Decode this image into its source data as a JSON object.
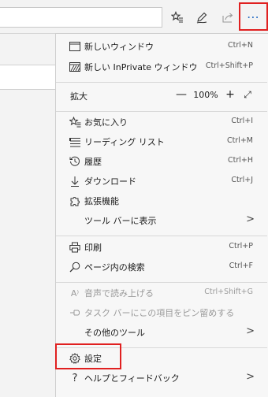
{
  "colors": {
    "accent": "#2b6fc6",
    "highlight": "#e02020"
  },
  "toolbar": {
    "favorites_add_icon": "star-plus-icon",
    "pen_icon": "pen-icon",
    "share_icon": "share-icon",
    "more_label": "⋯"
  },
  "menu": {
    "new_window": {
      "label": "新しいウィンドウ",
      "shortcut": "Ctrl+N"
    },
    "new_inprivate": {
      "label": "新しい InPrivate ウィンドウ",
      "shortcut": "Ctrl+Shift+P"
    },
    "zoom": {
      "label": "拡大",
      "minus": "—",
      "value": "100%",
      "plus": "+",
      "expand": "⤢"
    },
    "favorites": {
      "label": "お気に入り",
      "shortcut": "Ctrl+I"
    },
    "reading_list": {
      "label": "リーディング リスト",
      "shortcut": "Ctrl+M"
    },
    "history": {
      "label": "履歴",
      "shortcut": "Ctrl+H"
    },
    "downloads": {
      "label": "ダウンロード",
      "shortcut": "Ctrl+J"
    },
    "extensions": {
      "label": "拡張機能"
    },
    "show_in_toolbar": {
      "label": "ツール バーに表示",
      "arrow": ">"
    },
    "print": {
      "label": "印刷",
      "shortcut": "Ctrl+P"
    },
    "find": {
      "label": "ページ内の検索",
      "shortcut": "Ctrl+F"
    },
    "read_aloud": {
      "label": "音声で読み上げる",
      "shortcut": "Ctrl+Shift+G"
    },
    "pin_taskbar": {
      "label": "タスク バーにこの項目をピン留めする"
    },
    "more_tools": {
      "label": "その他のツール",
      "arrow": ">"
    },
    "settings": {
      "label": "設定"
    },
    "help": {
      "label": "ヘルプとフィードバック",
      "arrow": ">"
    }
  }
}
